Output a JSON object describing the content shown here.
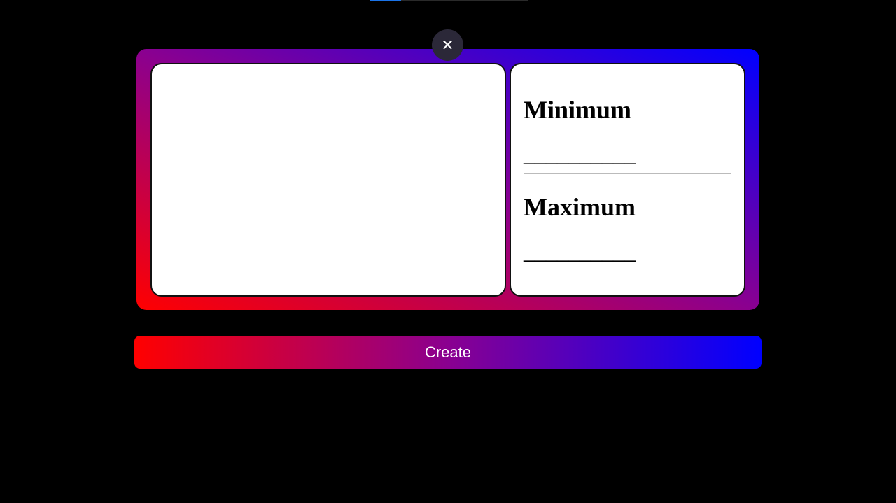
{
  "progress": {
    "fraction": 0.2
  },
  "close_icon": "close-icon",
  "range": {
    "minimum_label": "Minimum",
    "minimum_value": "__________",
    "maximum_label": "Maximum",
    "maximum_value": "__________"
  },
  "create_label": "Create",
  "colors": {
    "gradient_start": "#ff0000",
    "gradient_end": "#0000ff"
  }
}
